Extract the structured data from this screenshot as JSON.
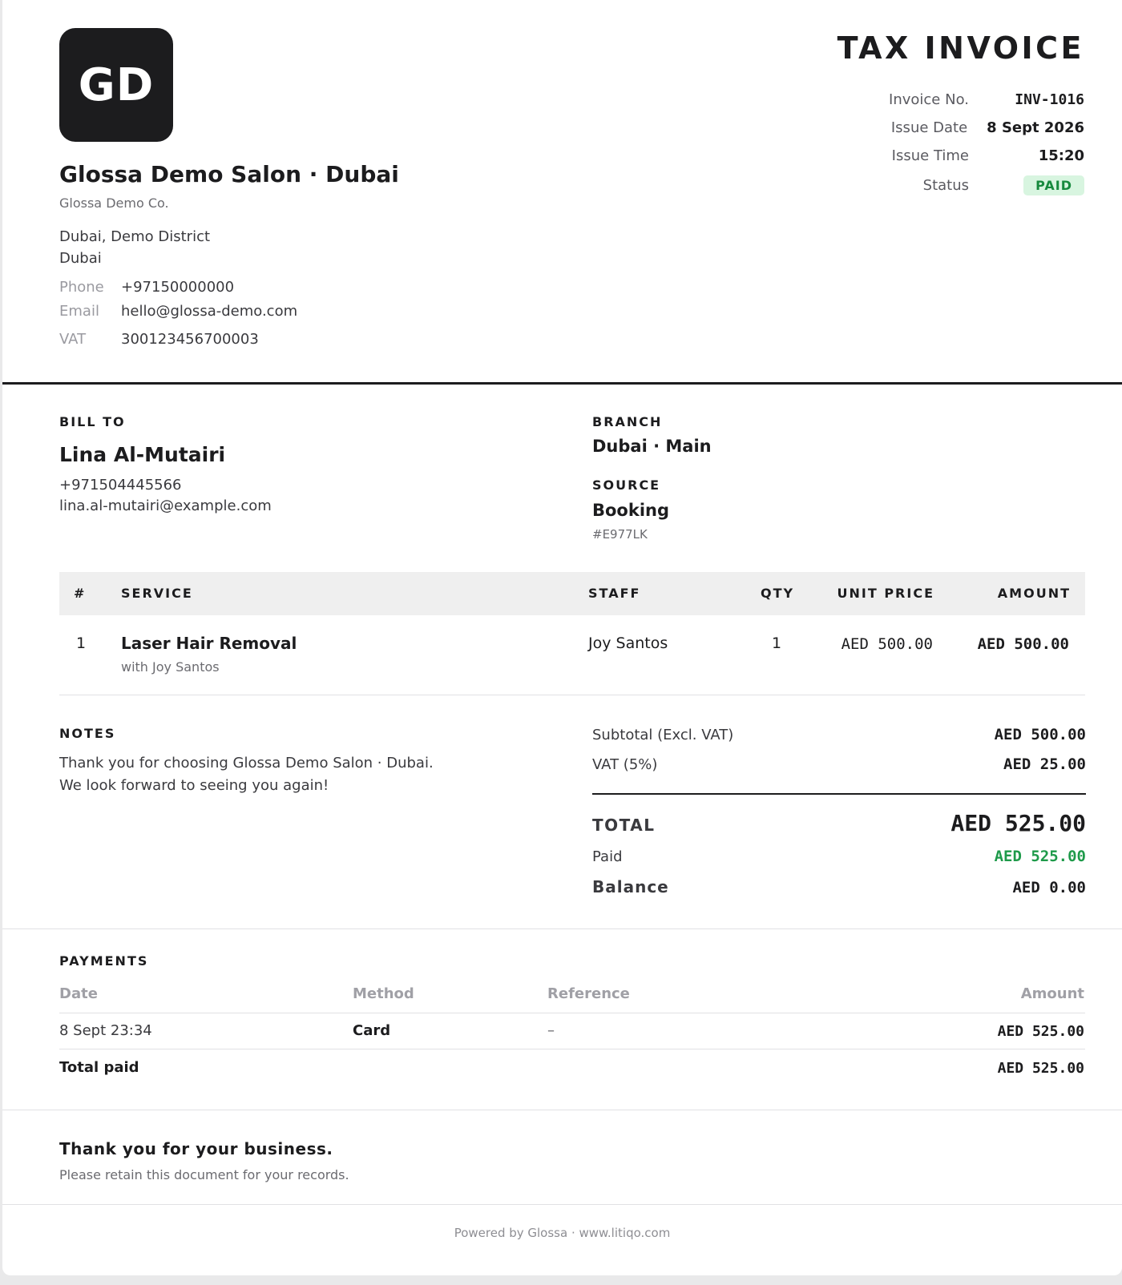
{
  "business": {
    "logo_initials": "GD",
    "name": "Glossa Demo Salon · Dubai",
    "legal_name": "Glossa Demo Co.",
    "address_line1": "Dubai, Demo District",
    "address_line2": "Dubai",
    "phone_label": "Phone",
    "phone": "+97150000000",
    "email_label": "Email",
    "email": "hello@glossa-demo.com",
    "vat_label": "VAT",
    "vat": "300123456700003"
  },
  "invoice": {
    "title": "TAX INVOICE",
    "number_label": "Invoice No.",
    "number": "INV-1016",
    "date_label": "Issue Date",
    "date": "8 Sept 2026",
    "time_label": "Issue Time",
    "time": "15:20",
    "status_label": "Status",
    "status": "PAID",
    "status_color": "#178a3e"
  },
  "bill_to": {
    "label": "BILL TO",
    "name": "Lina Al-Mutairi",
    "phone": "+971504445566",
    "email": "lina.al-mutairi@example.com"
  },
  "branch": {
    "label": "BRANCH",
    "value": "Dubai · Main"
  },
  "source": {
    "label": "SOURCE",
    "value": "Booking",
    "ref": "#E977LK"
  },
  "items": {
    "headers": {
      "num": "#",
      "service": "SERVICE",
      "staff": "STAFF",
      "qty": "QTY",
      "unit_price": "UNIT PRICE",
      "amount": "AMOUNT"
    },
    "rows": [
      {
        "num": "1",
        "service": "Laser Hair Removal",
        "sub": "with Joy Santos",
        "staff": "Joy Santos",
        "qty": "1",
        "unit_price": "AED 500.00",
        "amount": "AED 500.00"
      }
    ]
  },
  "notes": {
    "label": "NOTES",
    "line1": "Thank you for choosing Glossa Demo Salon · Dubai.",
    "line2": "We look forward to seeing you again!"
  },
  "totals": {
    "subtotal_label": "Subtotal (Excl. VAT)",
    "subtotal": "AED 500.00",
    "vat_label": "VAT (5%)",
    "vat": "AED 25.00",
    "total_label": "TOTAL",
    "total": "AED 525.00",
    "paid_label": "Paid",
    "paid": "AED 525.00",
    "paid_color": "#1e9a4a",
    "balance_label": "Balance",
    "balance": "AED 0.00"
  },
  "payments": {
    "label": "PAYMENTS",
    "headers": {
      "date": "Date",
      "method": "Method",
      "reference": "Reference",
      "amount": "Amount"
    },
    "rows": [
      {
        "date": "8 Sept 23:34",
        "method": "Card",
        "reference": "–",
        "amount": "AED 525.00"
      }
    ],
    "total_label": "Total paid",
    "total": "AED 525.00"
  },
  "footer": {
    "thanks": "Thank you for your business.",
    "retain": "Please retain this document for your records.",
    "powered": "Powered by Glossa · www.litiqo.com"
  }
}
